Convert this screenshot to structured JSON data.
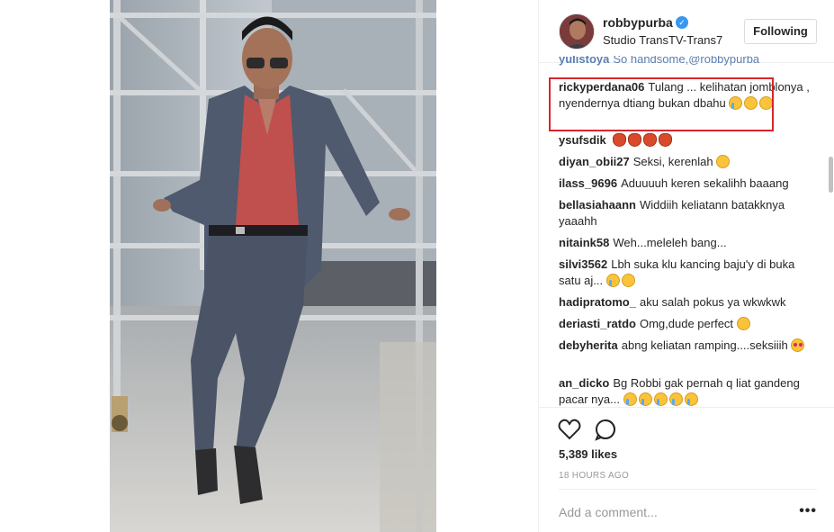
{
  "post": {
    "username": "robbypurba",
    "location": "Studio TransTV-Trans7",
    "follow_label": "Following"
  },
  "comments": [
    {
      "user": "yulistoya",
      "text": "So handsome,@robbypurba"
    },
    {
      "user": "rickyperdana06",
      "text": "Tulang ... kelihatan jomblonya , nyendernya dtiang bukan dbahu"
    },
    {
      "user": "ysufsdik",
      "text": ""
    },
    {
      "user": "diyan_obii27",
      "text": "Seksi, kerenlah"
    },
    {
      "user": "ilass_9696",
      "text": "Aduuuuh keren sekalihh baaang"
    },
    {
      "user": "bellasiahaann",
      "text": "Widdiih keliatann batakknya yaaahh"
    },
    {
      "user": "nitaink58",
      "text": "Weh...meleleh bang..."
    },
    {
      "user": "silvi3562",
      "text": "Lbh suka klu kancing baju'y di buka satu aj..."
    },
    {
      "user": "hadipratomo_",
      "text": "aku salah pokus ya wkwkwk"
    },
    {
      "user": "deriasti_ratdo",
      "text": "Omg,dude perfect"
    },
    {
      "user": "debyherita",
      "text": "abng keliatan ramping....seksiiih"
    },
    {
      "user": "an_dicko",
      "text": "Bg Robbi gak pernah q liat gandeng pacar nya..."
    }
  ],
  "engagement": {
    "likes": "5,389 likes",
    "time": "18 HOURS AGO",
    "comment_placeholder": "Add a comment...",
    "more_label": "•••"
  },
  "icons": {
    "like": "heart-icon",
    "comment": "comment-icon",
    "verified": "verified-badge-icon"
  },
  "colors": {
    "highlight": "#d9262c",
    "verified": "#3897f0"
  }
}
